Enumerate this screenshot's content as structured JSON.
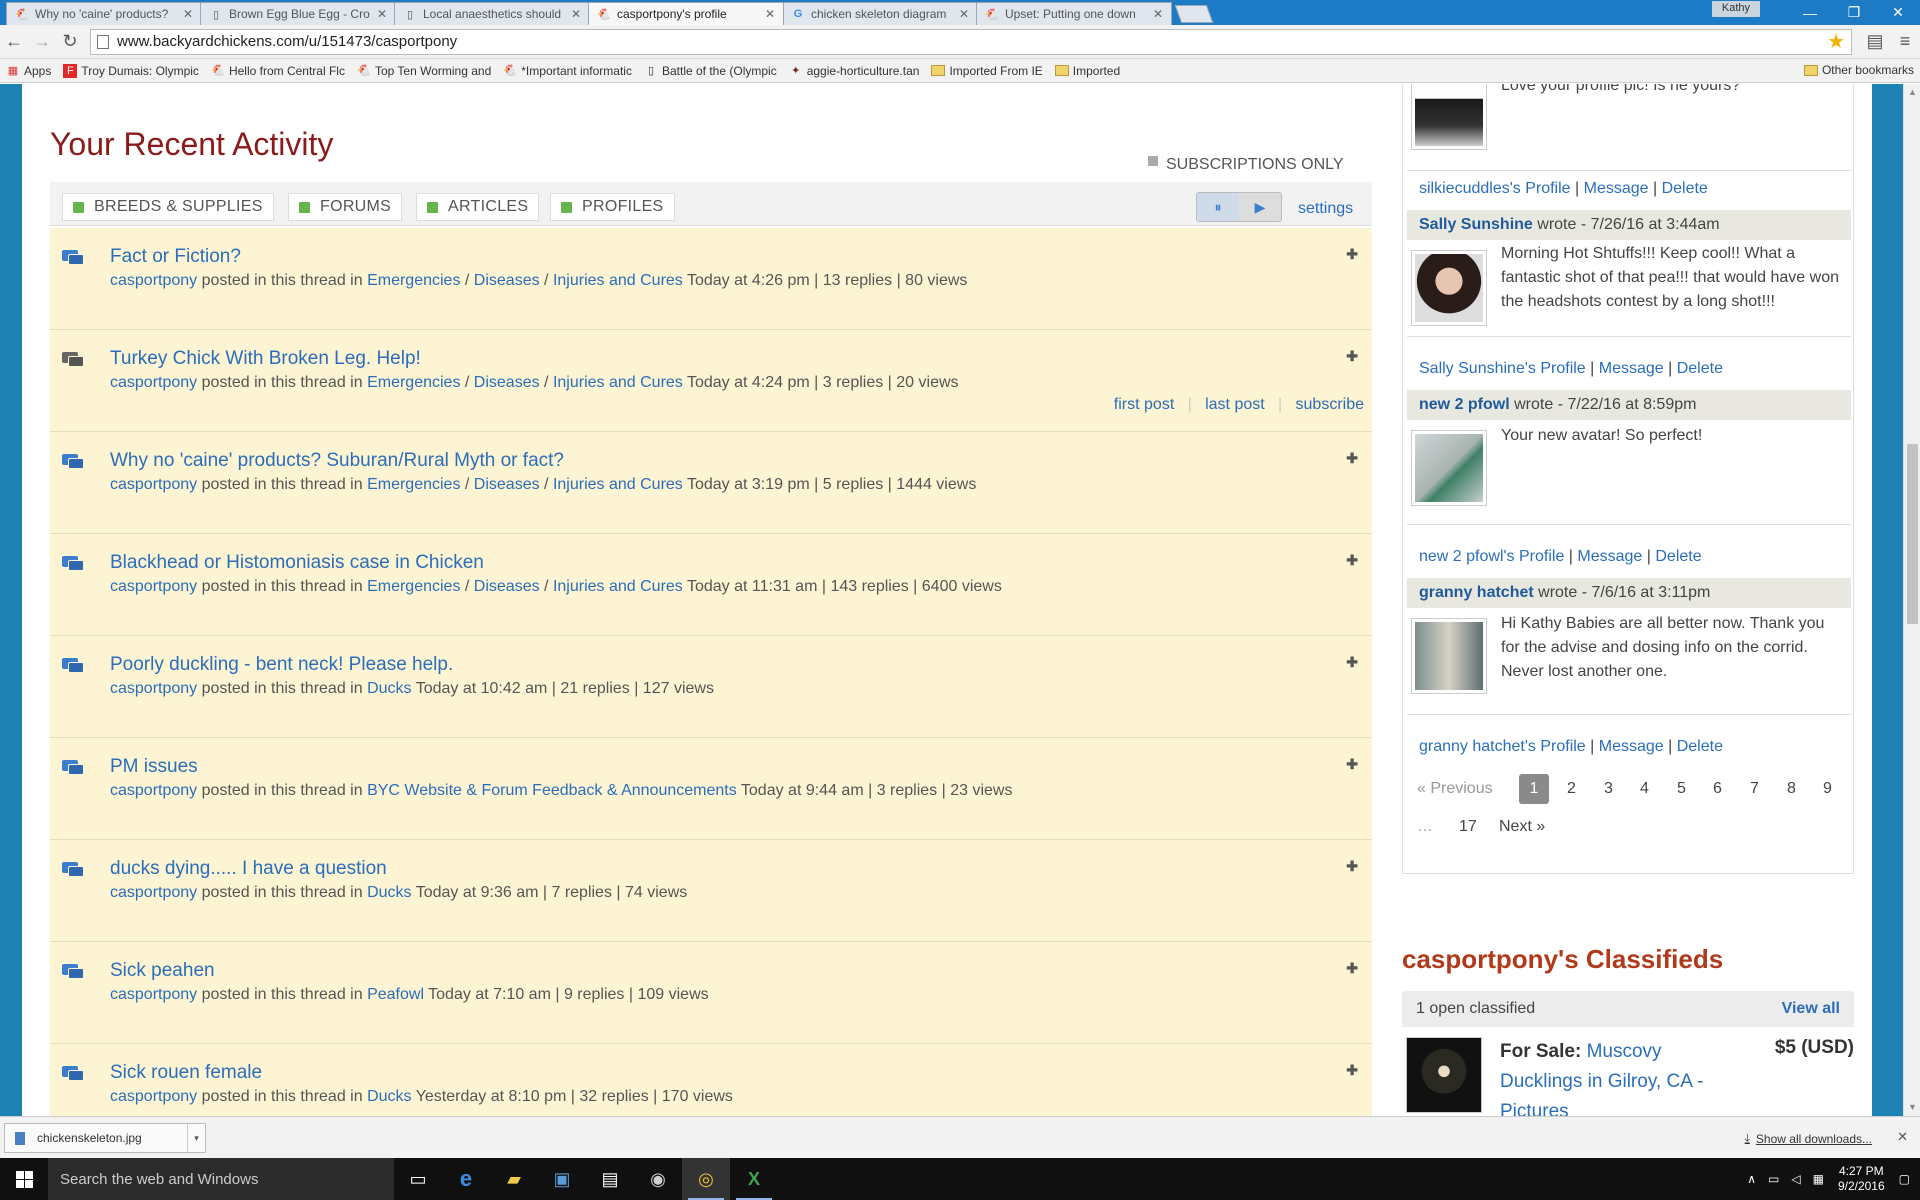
{
  "browser": {
    "tabs": [
      {
        "title": "Why no 'caine' products?",
        "icon": "backyard-chickens-icon",
        "active": false
      },
      {
        "title": "Brown Egg Blue Egg - Cro",
        "icon": "document-icon",
        "active": false
      },
      {
        "title": "Local anaesthetics should",
        "icon": "document-icon",
        "active": false
      },
      {
        "title": "casportpony's profile",
        "icon": "backyard-chickens-icon",
        "active": true
      },
      {
        "title": "chicken skeleton diagram",
        "icon": "google-icon",
        "active": false
      },
      {
        "title": "Upset: Putting one down",
        "icon": "backyard-chickens-icon",
        "active": false
      }
    ],
    "profile_name": "Kathy",
    "url": "www.backyardchickens.com/u/151473/casportpony",
    "bookmarks": [
      {
        "label": "Apps",
        "icon": "apps-grid-icon"
      },
      {
        "label": "Troy Dumais: Olympic",
        "icon": "flipboard-icon"
      },
      {
        "label": "Hello from Central Flc",
        "icon": "backyard-chickens-icon"
      },
      {
        "label": "Top Ten Worming and",
        "icon": "backyard-chickens-icon"
      },
      {
        "label": "*Important informatic",
        "icon": "backyard-chickens-icon"
      },
      {
        "label": "Battle of the (Olympic",
        "icon": "document-icon"
      },
      {
        "label": "aggie-horticulture.tan",
        "icon": "texas-icon"
      },
      {
        "label": "Imported From IE",
        "icon": "folder-icon"
      },
      {
        "label": "Imported",
        "icon": "folder-icon"
      }
    ],
    "other_bookmarks": "Other bookmarks"
  },
  "activity": {
    "title": "Your Recent Activity",
    "subscriptions_only": "SUBSCRIPTIONS ONLY",
    "filters": [
      "BREEDS & SUPPLIES",
      "FORUMS",
      "ARTICLES",
      "PROFILES"
    ],
    "settings_label": "settings",
    "posted_text": "posted in this thread in",
    "threads": [
      {
        "title": "Fact or Fiction?",
        "user": "casportpony",
        "categories": [
          "Emergencies",
          "Diseases",
          "Injuries and Cures"
        ],
        "stats": "Today at 4:26 pm | 13 replies | 80 views"
      },
      {
        "title": "Turkey Chick With Broken Leg. Help!",
        "user": "casportpony",
        "categories": [
          "Emergencies",
          "Diseases",
          "Injuries and Cures"
        ],
        "stats": "Today at 4:24 pm | 3 replies | 20 views",
        "links": [
          "first post",
          "last post",
          "subscribe"
        ]
      },
      {
        "title": "Why no 'caine' products? Suburan/Rural Myth or fact?",
        "user": "casportpony",
        "categories": [
          "Emergencies",
          "Diseases",
          "Injuries and Cures"
        ],
        "stats": "Today at 3:19 pm | 5 replies | 1444 views"
      },
      {
        "title": "Blackhead or Histomoniasis case in Chicken",
        "user": "casportpony",
        "categories": [
          "Emergencies",
          "Diseases",
          "Injuries and Cures"
        ],
        "stats": "Today at 11:31 am | 143 replies | 6400 views"
      },
      {
        "title": "Poorly duckling - bent neck! Please help.",
        "user": "casportpony",
        "categories": [
          "Ducks"
        ],
        "stats": "Today at 10:42 am | 21 replies | 127 views"
      },
      {
        "title": "PM issues",
        "user": "casportpony",
        "categories": [
          "BYC Website & Forum Feedback & Announcements"
        ],
        "stats": "Today at 9:44 am | 3 replies | 23 views"
      },
      {
        "title": "ducks dying..... I have a question",
        "user": "casportpony",
        "categories": [
          "Ducks"
        ],
        "stats": "Today at 9:36 am | 7 replies | 74 views"
      },
      {
        "title": "Sick peahen",
        "user": "casportpony",
        "categories": [
          "Peafowl"
        ],
        "stats": "Today at 7:10 am | 9 replies | 109 views"
      },
      {
        "title": "Sick rouen female",
        "user": "casportpony",
        "categories": [
          "Ducks"
        ],
        "stats": "Yesterday at 8:10 pm | 32 replies | 170 views"
      }
    ]
  },
  "comments": {
    "first_text": "Love your profile pic! Is he yours?",
    "items": [
      {
        "links_user": "silkiecuddles's Profile",
        "message": "Message",
        "delete": "Delete"
      },
      {
        "author": "Sally Sunshine",
        "wrote": "wrote - 7/26/16 at 3:44am",
        "text": "Morning Hot Shtuffs!!! Keep cool!! What a fantastic shot of that pea!!! that would have won the headshots contest by a long shot!!!",
        "links_user": "Sally Sunshine's Profile",
        "message": "Message",
        "delete": "Delete"
      },
      {
        "author": "new 2 pfowl",
        "wrote": "wrote - 7/22/16 at 8:59pm",
        "text": "Your new avatar! So perfect!",
        "links_user": "new 2 pfowl's Profile",
        "message": "Message",
        "delete": "Delete"
      },
      {
        "author": "granny hatchet",
        "wrote": "wrote - 7/6/16 at 3:11pm",
        "text": "Hi Kathy Babies are all better now. Thank you for the advise and dosing info on the corrid. Never lost another one.",
        "links_user": "granny hatchet's Profile",
        "message": "Message",
        "delete": "Delete"
      }
    ],
    "pager": {
      "previous": "« Previous",
      "pages": [
        "1",
        "2",
        "3",
        "4",
        "5",
        "6",
        "7",
        "8",
        "9"
      ],
      "ellipsis": "…",
      "last": "17",
      "next": "Next »"
    }
  },
  "classifieds": {
    "title": "casportpony's Classifieds",
    "count_text": "1 open classified",
    "view_all": "View all",
    "item": {
      "prefix": "For Sale:",
      "title": "Muscovy Ducklings in Gilroy, CA - Pictures",
      "price": "$5 (USD)"
    }
  },
  "downloads": {
    "file": "chickenskeleton.jpg",
    "show_all": "Show all downloads..."
  },
  "taskbar": {
    "search_placeholder": "Search the web and Windows",
    "time": "4:27 PM",
    "date": "9/2/2016"
  }
}
